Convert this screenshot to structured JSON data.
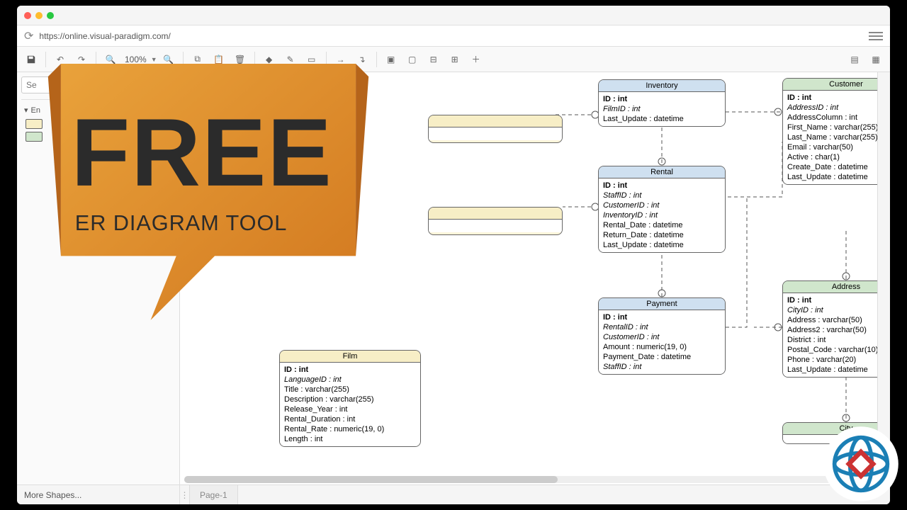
{
  "window": {
    "url": "https://online.visual-paradigm.com/"
  },
  "toolbar": {
    "zoom": "100%"
  },
  "sidebar": {
    "search_placeholder": "Se",
    "group_label": "En",
    "more_shapes": "More Shapes..."
  },
  "tabs": {
    "page1": "Page-1"
  },
  "promo": {
    "main": "FREE",
    "sub": "ER DIAGRAM TOOL"
  },
  "entities": {
    "film": {
      "name": "Film",
      "rows": [
        {
          "text": "ID : int",
          "bold": true
        },
        {
          "text": "LanguageID : int",
          "ital": true
        },
        {
          "text": "Title : varchar(255)"
        },
        {
          "text": "Description : varchar(255)"
        },
        {
          "text": "Release_Year : int"
        },
        {
          "text": "Rental_Duration : int"
        },
        {
          "text": "Rental_Rate : numeric(19, 0)"
        },
        {
          "text": "Length : int"
        }
      ]
    },
    "inventory": {
      "name": "Inventory",
      "rows": [
        {
          "text": "ID : int",
          "bold": true
        },
        {
          "text": "FilmID : int",
          "ital": true
        },
        {
          "text": "Last_Update : datetime"
        }
      ]
    },
    "rental": {
      "name": "Rental",
      "rows": [
        {
          "text": "ID : int",
          "bold": true
        },
        {
          "text": "StaffID : int",
          "ital": true
        },
        {
          "text": "CustomerID : int",
          "ital": true
        },
        {
          "text": "InventoryID : int",
          "ital": true
        },
        {
          "text": "Rental_Date : datetime"
        },
        {
          "text": "Return_Date : datetime"
        },
        {
          "text": "Last_Update : datetime"
        }
      ]
    },
    "payment": {
      "name": "Payment",
      "rows": [
        {
          "text": "ID : int",
          "bold": true
        },
        {
          "text": "RentalID : int",
          "ital": true
        },
        {
          "text": "CustomerID : int",
          "ital": true
        },
        {
          "text": "Amount : numeric(19, 0)"
        },
        {
          "text": "Payment_Date : datetime"
        },
        {
          "text": "StaffID : int",
          "ital": true
        }
      ]
    },
    "customer": {
      "name": "Customer",
      "rows": [
        {
          "text": "ID : int",
          "bold": true
        },
        {
          "text": "AddressID : int",
          "ital": true
        },
        {
          "text": "AddressColumn : int"
        },
        {
          "text": "First_Name : varchar(255)"
        },
        {
          "text": "Last_Name : varchar(255)"
        },
        {
          "text": "Email : varchar(50)"
        },
        {
          "text": "Active : char(1)"
        },
        {
          "text": "Create_Date : datetime"
        },
        {
          "text": "Last_Update : datetime"
        }
      ]
    },
    "address": {
      "name": "Address",
      "rows": [
        {
          "text": "ID : int",
          "bold": true
        },
        {
          "text": "CityID : int",
          "ital": true
        },
        {
          "text": "Address : varchar(50)"
        },
        {
          "text": "Address2 : varchar(50)"
        },
        {
          "text": "District : int"
        },
        {
          "text": "Postal_Code : varchar(10)"
        },
        {
          "text": "Phone : varchar(20)"
        },
        {
          "text": "Last_Update : datetime"
        }
      ]
    },
    "city": {
      "name": "City",
      "rows": []
    }
  }
}
